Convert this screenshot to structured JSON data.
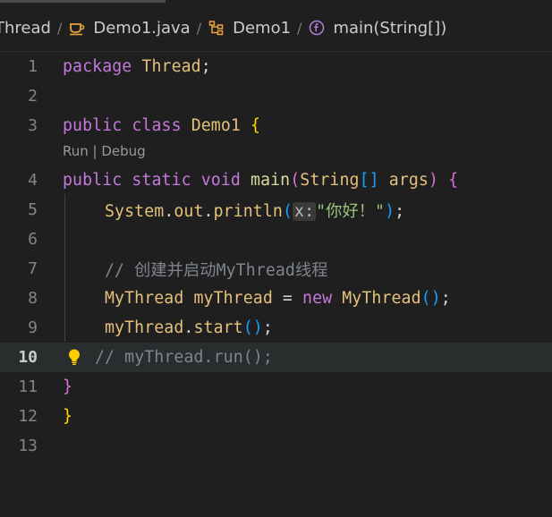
{
  "breadcrumb": {
    "items": [
      {
        "label": "Thread",
        "icon": "none"
      },
      {
        "label": "Demo1.java",
        "icon": "java-cup-icon"
      },
      {
        "label": "Demo1",
        "icon": "class-icon"
      },
      {
        "label": "main(String[])",
        "icon": "method-icon"
      }
    ],
    "separator": "/"
  },
  "codelens": {
    "run": "Run",
    "divider": " | ",
    "debug": "Debug"
  },
  "lines": {
    "l1": {
      "num": "1",
      "pkg_kw": "package",
      "pkg_name": "Thread",
      "semi": ";"
    },
    "l2": {
      "num": "2"
    },
    "l3": {
      "num": "3",
      "public": "public",
      "class": "class",
      "name": "Demo1",
      "brace": "{"
    },
    "l4": {
      "num": "4",
      "public": "public",
      "static": "static",
      "void": "void",
      "main": "main",
      "lp": "(",
      "type": "String",
      "arr": "[]",
      "args": "args",
      "rp": ")",
      "brace": "{"
    },
    "l5": {
      "num": "5",
      "sys": "System",
      "dot1": ".",
      "out": "out",
      "dot2": ".",
      "println": "println",
      "lp": "(",
      "inlay": "x:",
      "str": "\"你好！\"",
      "rp": ")",
      "semi": ";"
    },
    "l6": {
      "num": "6"
    },
    "l7": {
      "num": "7",
      "comment": "// 创建并启动MyThread线程"
    },
    "l8": {
      "num": "8",
      "type": "MyThread",
      "var": "myThread",
      "eq": " = ",
      "new": "new",
      "ctor": "MyThread",
      "parens": "()",
      "semi": ";"
    },
    "l9": {
      "num": "9",
      "var": "myThread",
      "dot": ".",
      "start": "start",
      "parens": "()",
      "semi": ";"
    },
    "l10": {
      "num": "10",
      "comment": "// myThread.run();"
    },
    "l11": {
      "num": "11",
      "brace": "}"
    },
    "l12": {
      "num": "12",
      "brace": "}"
    },
    "l13": {
      "num": "13"
    }
  },
  "colors": {
    "background": "#1f1f1f",
    "keyword": "#c678dd",
    "type": "#e5c07b",
    "string": "#98c379",
    "comment": "#7f848e",
    "brace_gold": "#ffd700",
    "brace_violet": "#da70d6",
    "brace_blue": "#179fff"
  }
}
